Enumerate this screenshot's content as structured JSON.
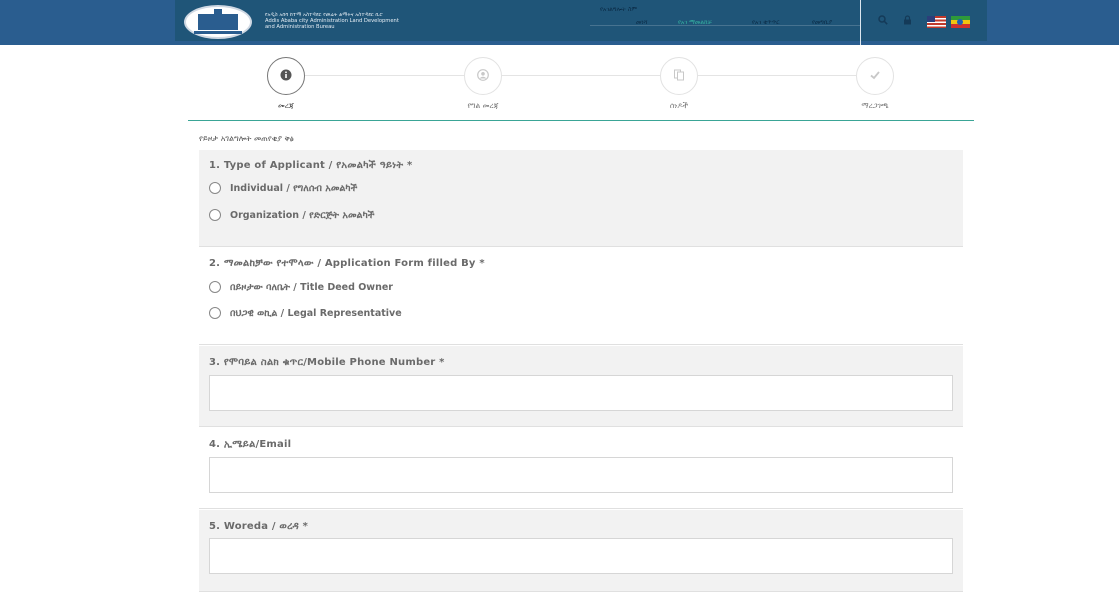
{
  "header": {
    "org_line1": "የአዲስ አበባ ከተማ አስተዳደር የመሬት ልማትና አስተዳደር ቢሮ",
    "org_line2": "Addis Ababa city Administration Land Development",
    "org_line3": "and Administration Bureau",
    "top_link": "የአገልግሎት ስም",
    "nav": [
      "መነሻ",
      "የአገ ማመልከቻ",
      "የአገ ቁጥጥር",
      "የመግቢያ"
    ],
    "search_icon": "search-icon",
    "lock_icon": "lock-icon",
    "flags": [
      "us-flag",
      "ethiopia-flag"
    ]
  },
  "stepper": {
    "steps": [
      {
        "label": "መረጃ",
        "icon": "info-icon",
        "active": true
      },
      {
        "label": "የግል መረጃ",
        "icon": "user-icon",
        "active": false
      },
      {
        "label": "ሰነዶች",
        "icon": "documents-icon",
        "active": false
      },
      {
        "label": "ማረጋገጫ",
        "icon": "check-icon",
        "active": false
      }
    ]
  },
  "form": {
    "title": "የይዞታ አገልግሎት መጠየቂያ ቅፅ",
    "q1": {
      "label": "1. Type of Applicant / የአመልካች ዓይነት *",
      "options": [
        "Individual / የግለሰብ አመልካች",
        "Organization / የድርጅት አመልካች"
      ]
    },
    "q2": {
      "label": "2. ማመልከቻው የተሞላው / Application Form filled By *",
      "options": [
        "በይዞታው ባለቤት / Title Deed Owner",
        "በህጋዊ ወኪል / Legal Representative"
      ]
    },
    "q3": {
      "label": "3. የሞባይል ስልክ ቁጥር/Mobile Phone Number *",
      "value": ""
    },
    "q4": {
      "label": "4. ኢሜይል/Email",
      "value": ""
    },
    "q5": {
      "label": "5. Woreda / ወረዳ *",
      "value": ""
    }
  }
}
